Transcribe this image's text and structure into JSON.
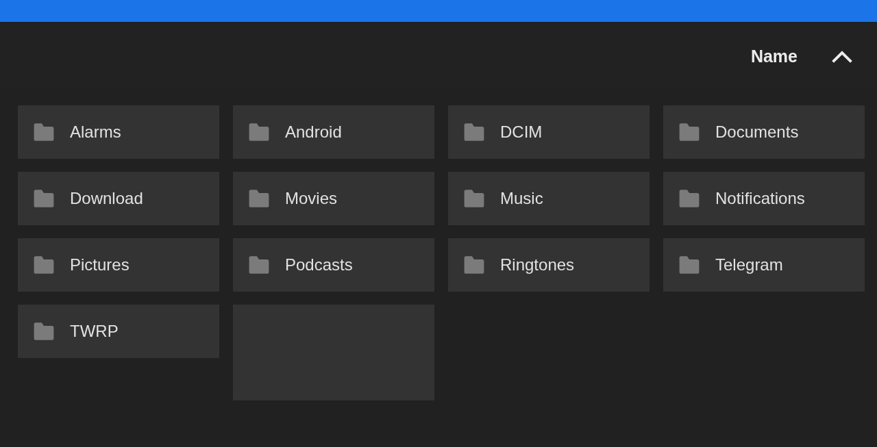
{
  "sort_header": {
    "label": "Name",
    "ascending": true
  },
  "items": [
    {
      "kind": "folder",
      "name": "Alarms"
    },
    {
      "kind": "folder",
      "name": "Android"
    },
    {
      "kind": "folder",
      "name": "DCIM"
    },
    {
      "kind": "folder",
      "name": "Documents"
    },
    {
      "kind": "folder",
      "name": "Download"
    },
    {
      "kind": "folder",
      "name": "Movies"
    },
    {
      "kind": "folder",
      "name": "Music"
    },
    {
      "kind": "folder",
      "name": "Notifications"
    },
    {
      "kind": "folder",
      "name": "Pictures"
    },
    {
      "kind": "folder",
      "name": "Podcasts"
    },
    {
      "kind": "folder",
      "name": "Ringtones"
    },
    {
      "kind": "folder",
      "name": "Telegram"
    },
    {
      "kind": "folder",
      "name": "TWRP"
    },
    {
      "kind": "file"
    }
  ]
}
